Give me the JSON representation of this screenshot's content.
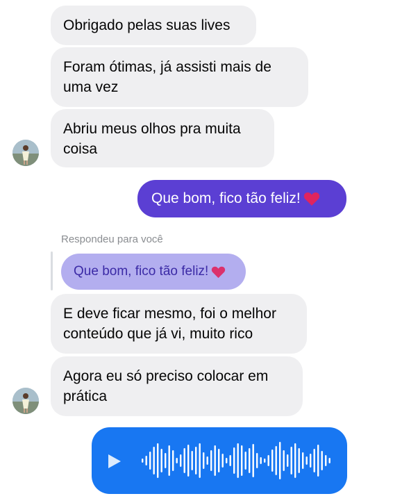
{
  "messages": [
    {
      "text": "Obrigado pelas suas lives"
    },
    {
      "text": "Foram ótimas, já assisti mais de uma vez"
    },
    {
      "text": "Abriu meus olhos pra muita coisa"
    },
    {
      "text": "E deve ficar mesmo, foi o melhor conteúdo que já vi, muito rico"
    },
    {
      "text": "Agora eu só preciso colocar em prática"
    }
  ],
  "sent_message": {
    "text": "Que bom, fico tão feliz!",
    "emoji": "heart-emoji"
  },
  "reply": {
    "label": "Respondeu para você",
    "quoted_text": "Que bom, fico tão feliz!"
  },
  "voice_message": {
    "play_icon": "play-icon",
    "accent": "#1877f2"
  },
  "colors": {
    "received_bubble": "#efeff1",
    "sent_bubble": "#5b3fd3",
    "quoted_bubble": "#b3aeef",
    "voice_bubble": "#1877f2",
    "heart": "#e0245e"
  }
}
